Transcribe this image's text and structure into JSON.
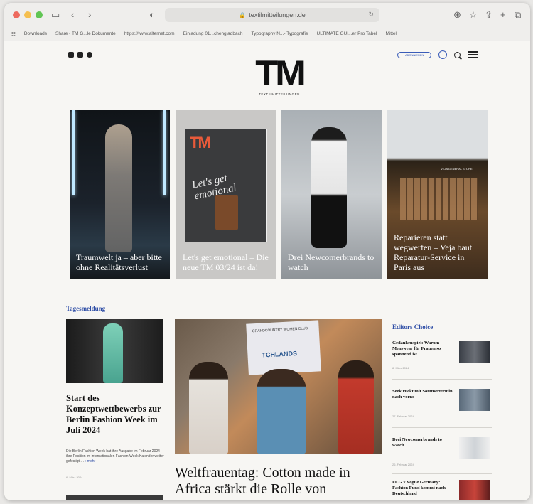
{
  "browser": {
    "url": "textilmitteilungen.de",
    "bookmarks": [
      "Downloads",
      "Share - TM G...le Dokumente",
      "https://www.alternet.com",
      "Einladung 01...chengladbach",
      "Typography N...- Typografie",
      "ULTIMATE GUI...er Pro Tabel",
      "Mittel"
    ]
  },
  "header": {
    "logo_text": "TM",
    "logo_sub": "TEXTILMITTEILUNGEN",
    "subscribe_label": "ABONNIEREN"
  },
  "cards": [
    {
      "caption": "Traumwelt ja – aber bitte ohne Realitätsverlust"
    },
    {
      "caption": "Let's get emotional – Die neue TM 03/24 ist da!",
      "mag_logo": "TM",
      "mag_script": "Let's get emotional"
    },
    {
      "caption": "Drei Newcomerbrands to watch"
    },
    {
      "caption": "Reparieren statt wegwerfen – Veja baut Reparatur-Service in Paris aus",
      "store_sign": "VEJA GENERAL STORE"
    }
  ],
  "tagesmeldung": {
    "label": "Tagesmeldung",
    "title": "Start des Konzeptwettbewerbs zur Berlin Fashion Week im Juli 2024",
    "text": "Die Berlin Fashion Week hat ihre Ausgabe im Februar 2024 ihre Position im internationalen Fashion Week Kalender weiter gefestigt.…",
    "more": "› mehr",
    "date": "6. März 2024"
  },
  "main_story": {
    "title": "Weltfrauentag: Cotton made in Africa stärkt die Rolle von",
    "banner_text": "GRANDCOUNTRY WOMEN CLUB",
    "banner_logo": "TCHLANDS"
  },
  "editors_choice": {
    "label": "Editors Choice",
    "items": [
      {
        "title": "Gedankenspiel: Warum Menswear für Frauen so spannend ist",
        "date": "8. März 2024"
      },
      {
        "title": "Seek rückt mit Sommertermin nach vorne",
        "date": "27. Februar 2024"
      },
      {
        "title": "Drei Newcomerbrands to watch",
        "date": "26. Februar 2024"
      },
      {
        "title": "FCG x Vogue Germany: Fashion Fund kommt nach Deutschland",
        "date": ""
      }
    ]
  }
}
